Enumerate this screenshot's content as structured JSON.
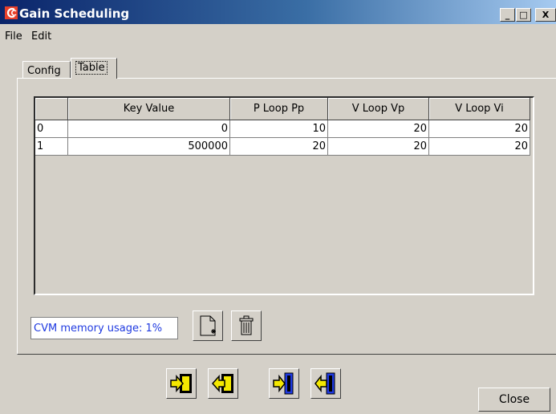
{
  "window": {
    "title": "Gain Scheduling",
    "min_symbol": "_",
    "max_symbol": "□",
    "close_symbol": "X"
  },
  "menu": {
    "items": [
      "File",
      "Edit"
    ]
  },
  "tabs": [
    {
      "label": "Config",
      "active": false
    },
    {
      "label": "Table",
      "active": true
    }
  ],
  "table": {
    "columns": [
      "",
      "Key Value",
      "P Loop Pp",
      "V Loop Vp",
      "V Loop Vi"
    ],
    "rows": [
      [
        "0",
        "0",
        "10",
        "20",
        "20"
      ],
      [
        "1",
        "500000",
        "20",
        "20",
        "20"
      ]
    ]
  },
  "status": {
    "text": "CVM memory usage: 1%"
  },
  "tools": {
    "new_icon": "new-document-icon",
    "delete_icon": "trash-icon"
  },
  "transfer_buttons": [
    "import-icon",
    "export-icon",
    "download-icon",
    "upload-icon"
  ],
  "close_button": {
    "label": "Close"
  },
  "colors": {
    "title_bar": "#0a246a",
    "status_text": "#1f3ae0",
    "icon_yellow": "#f4e800"
  }
}
